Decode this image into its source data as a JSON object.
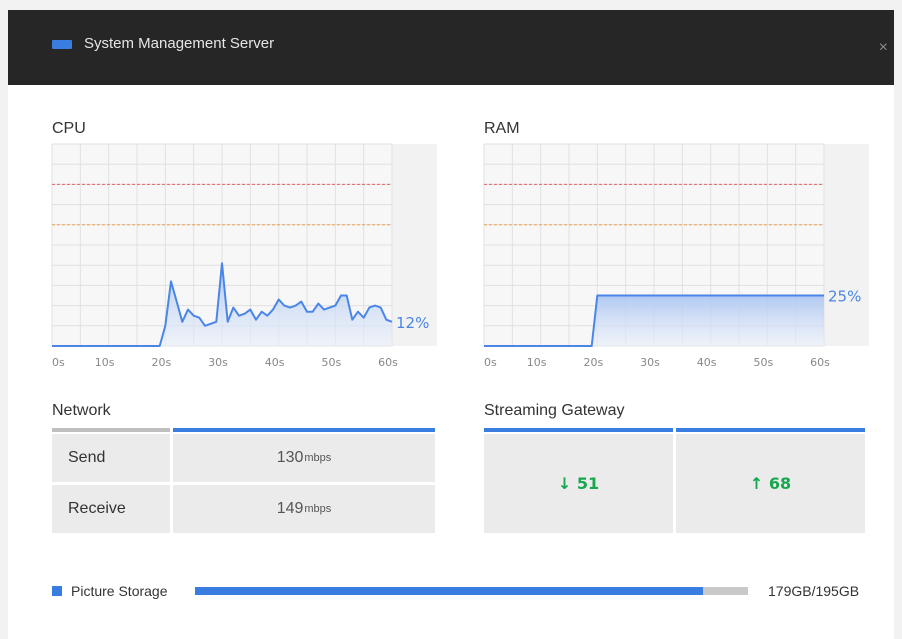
{
  "window": {
    "title": "System Management Server",
    "close_label": "×"
  },
  "cpu": {
    "title": "CPU",
    "current_label": "12%",
    "x_ticks": [
      "0s",
      "10s",
      "20s",
      "30s",
      "40s",
      "50s",
      "60s"
    ],
    "colors": {
      "line": "#4a86e8",
      "high_threshold": "#e06666",
      "mid_threshold": "#f0a050"
    }
  },
  "ram": {
    "title": "RAM",
    "current_label": "25%",
    "x_ticks": [
      "0s",
      "10s",
      "20s",
      "30s",
      "40s",
      "50s",
      "60s"
    ]
  },
  "network": {
    "title": "Network",
    "rows": [
      {
        "label": "Send",
        "value": "130",
        "unit": "mbps"
      },
      {
        "label": "Receive",
        "value": "149",
        "unit": "mbps"
      }
    ]
  },
  "gateway": {
    "title": "Streaming Gateway",
    "down": "↓ 51",
    "up": "↑ 68",
    "value_color": "#17a84f"
  },
  "storage": {
    "label": "Picture Storage",
    "value": "179GB/195GB",
    "used_gb": 179,
    "total_gb": 195
  },
  "chart_data": [
    {
      "type": "area",
      "title": "CPU",
      "x_unit": "s",
      "xlim": [
        0,
        60
      ],
      "ylim": [
        0,
        100
      ],
      "y_ticks_hidden": true,
      "thresholds": [
        80,
        60
      ],
      "grid": true,
      "series": [
        {
          "x": [
            0,
            19,
            20,
            21,
            22,
            23,
            24,
            25,
            26,
            27,
            28,
            29,
            30,
            31,
            32,
            33,
            34,
            35,
            36,
            37,
            38,
            39,
            40,
            41,
            42,
            43,
            44,
            45,
            46,
            47,
            48,
            49,
            50,
            51,
            52,
            53,
            54,
            55,
            56,
            57,
            58,
            59,
            60
          ],
          "y": [
            0,
            0,
            10,
            32,
            22,
            12,
            18,
            15,
            14,
            10,
            11,
            12,
            41,
            12,
            19,
            15,
            16,
            18,
            13,
            17,
            15,
            18,
            23,
            20,
            19,
            20,
            22,
            17,
            17,
            21,
            18,
            19,
            20,
            25,
            25,
            13,
            17,
            14,
            19,
            20,
            19,
            13,
            12
          ]
        }
      ]
    },
    {
      "type": "area",
      "title": "RAM",
      "x_unit": "s",
      "xlim": [
        0,
        60
      ],
      "ylim": [
        0,
        100
      ],
      "y_ticks_hidden": true,
      "thresholds": [
        80,
        60
      ],
      "grid": true,
      "series": [
        {
          "x": [
            0,
            19,
            20,
            60
          ],
          "y": [
            0,
            0,
            25,
            25
          ]
        }
      ]
    }
  ]
}
